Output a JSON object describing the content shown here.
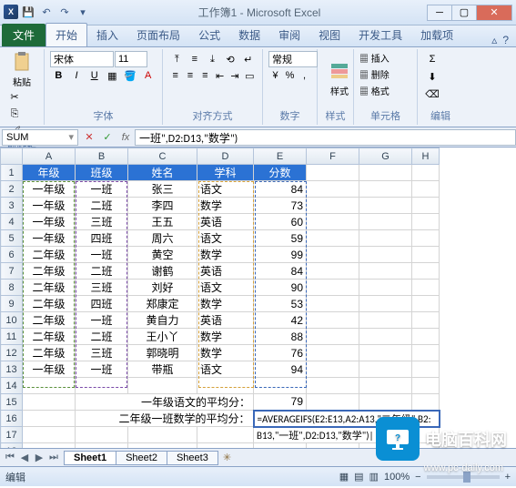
{
  "window": {
    "title": "工作簿1 - Microsoft Excel",
    "app_initial": "X"
  },
  "tabs": {
    "file": "文件",
    "items": [
      "开始",
      "插入",
      "页面布局",
      "公式",
      "数据",
      "审阅",
      "视图",
      "开发工具",
      "加载项"
    ],
    "active_index": 0
  },
  "ribbon": {
    "clipboard": {
      "paste": "粘贴",
      "label": "剪贴板"
    },
    "font": {
      "family": "宋体",
      "size": "11",
      "label": "字体"
    },
    "alignment": {
      "label": "对齐方式"
    },
    "number": {
      "label": "数字",
      "format": "常规"
    },
    "styles": {
      "label": "样式"
    },
    "cells": {
      "insert": "插入",
      "delete": "删除",
      "format": "格式",
      "label": "单元格"
    },
    "editing": {
      "label": "编辑"
    }
  },
  "formula_bar": {
    "name_box": "SUM",
    "formula_tail": "一班\",D2:D13,\"数学\")"
  },
  "columns": [
    "A",
    "B",
    "C",
    "D",
    "E",
    "F",
    "G",
    "H"
  ],
  "headers": [
    "年级",
    "班级",
    "姓名",
    "学科",
    "分数"
  ],
  "rows": [
    {
      "n": 2,
      "a": "一年级",
      "b": "一班",
      "c": "张三",
      "d": "语文",
      "e": "84"
    },
    {
      "n": 3,
      "a": "一年级",
      "b": "二班",
      "c": "李四",
      "d": "数学",
      "e": "73"
    },
    {
      "n": 4,
      "a": "一年级",
      "b": "三班",
      "c": "王五",
      "d": "英语",
      "e": "60"
    },
    {
      "n": 5,
      "a": "一年级",
      "b": "四班",
      "c": "周六",
      "d": "语文",
      "e": "59"
    },
    {
      "n": 6,
      "a": "二年级",
      "b": "一班",
      "c": "黄空",
      "d": "数学",
      "e": "99"
    },
    {
      "n": 7,
      "a": "二年级",
      "b": "二班",
      "c": "谢鹤",
      "d": "英语",
      "e": "84"
    },
    {
      "n": 8,
      "a": "二年级",
      "b": "三班",
      "c": "刘好",
      "d": "语文",
      "e": "90"
    },
    {
      "n": 9,
      "a": "二年级",
      "b": "四班",
      "c": "郑康定",
      "d": "数学",
      "e": "53"
    },
    {
      "n": 10,
      "a": "二年级",
      "b": "一班",
      "c": "黄自力",
      "d": "英语",
      "e": "42"
    },
    {
      "n": 11,
      "a": "二年级",
      "b": "二班",
      "c": "王小丫",
      "d": "数学",
      "e": "88"
    },
    {
      "n": 12,
      "a": "二年级",
      "b": "三班",
      "c": "郭晓明",
      "d": "数学",
      "e": "76"
    },
    {
      "n": 13,
      "a": "一年级",
      "b": "一班",
      "c": "带瓶",
      "d": "语文",
      "e": "94"
    }
  ],
  "summary": {
    "row15_label": "一年级语文的平均分：",
    "row15_value": "79",
    "row16_label": "二年级一班数学的平均分：",
    "row16_formula_line1": "=AVERAGEIFS(E2:E13,A2:A13,\"二年级\",B2:",
    "row16_formula_line2": "B13,\"一班\",D2:D13,\"数学\")|"
  },
  "sheets": [
    "Sheet1",
    "Sheet2",
    "Sheet3"
  ],
  "statusbar": {
    "mode": "编辑",
    "zoom": "100%"
  },
  "watermark": {
    "text": "电脑百科网",
    "url": "www.pc-daily.com"
  }
}
